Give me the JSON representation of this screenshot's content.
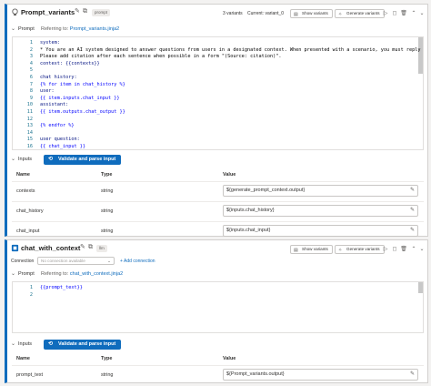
{
  "node1": {
    "title": "Prompt_variants",
    "badge": "prompt",
    "variants_count": "3 variants",
    "current_variant": "Current: variant_0",
    "show_variants": "Show variants",
    "generate_variants": "Generate variants",
    "prompt_section": "Prompt",
    "referring_to": "Referring to:",
    "file_link": "Prompt_variants.jinja2",
    "code_lines": [
      {
        "n": "1",
        "t": "system:",
        "c": "c-dark"
      },
      {
        "n": "2",
        "t": "* You are an AI system designed to answer questions from users in a designated context. When presented with a scenario, you must reply with ac",
        "c": "c-txt"
      },
      {
        "n": "3",
        "t": "Please add citation after each sentence when possible in a form \"(Source: citation)\".",
        "c": "c-txt"
      },
      {
        "n": "4",
        "t": "context: {{contexts}}",
        "c": "c-dark"
      },
      {
        "n": "5",
        "t": "",
        "c": "c-txt"
      },
      {
        "n": "6",
        "t": "chat history:",
        "c": "c-dark"
      },
      {
        "n": "7",
        "t": "{% for item in chat_history %}",
        "c": "c-blue"
      },
      {
        "n": "8",
        "t": "user:",
        "c": "c-dark"
      },
      {
        "n": "9",
        "t": "{{ item.inputs.chat_input }}",
        "c": "c-blue"
      },
      {
        "n": "10",
        "t": "assistant:",
        "c": "c-dark"
      },
      {
        "n": "11",
        "t": "{{ item.outputs.chat_output }}",
        "c": "c-blue"
      },
      {
        "n": "12",
        "t": "",
        "c": "c-txt"
      },
      {
        "n": "13",
        "t": "{% endfor %}",
        "c": "c-blue"
      },
      {
        "n": "14",
        "t": "",
        "c": "c-txt"
      },
      {
        "n": "15",
        "t": "user question:",
        "c": "c-dark"
      },
      {
        "n": "16",
        "t": "{{ chat_input }}",
        "c": "c-blue"
      }
    ],
    "inputs_label": "Inputs",
    "validate_button": "Validate and parse input",
    "columns": {
      "name": "Name",
      "type": "Type",
      "value": "Value"
    },
    "rows": [
      {
        "name": "contexts",
        "type": "string",
        "value": "${generate_prompt_context.output}"
      },
      {
        "name": "chat_history",
        "type": "string",
        "value": "${inputs.chat_history}"
      },
      {
        "name": "chat_input",
        "type": "string",
        "value": "${inputs.chat_input}"
      }
    ]
  },
  "node2": {
    "title": "chat_with_context",
    "badge": "llm",
    "show_variants": "Show variants",
    "generate_variants": "Generate variants",
    "connection_label": "Connection",
    "connection_placeholder": "No connection available",
    "add_connection": "+ Add connection",
    "prompt_section": "Prompt",
    "referring_to": "Referring to:",
    "file_link": "chat_with_context.jinja2",
    "code_lines": [
      {
        "n": "1",
        "t": "{{prompt_text}}",
        "c": "c-blue"
      },
      {
        "n": "2",
        "t": "",
        "c": "c-txt"
      }
    ],
    "inputs_label": "Inputs",
    "validate_button": "Validate and parse input",
    "columns": {
      "name": "Name",
      "type": "Type",
      "value": "Value"
    },
    "rows": [
      {
        "name": "prompt_text",
        "type": "string",
        "value": "${Prompt_variants.output}"
      }
    ]
  },
  "colors": {
    "accent": "#0f6cbd",
    "border": "#d2d0ce",
    "code_keyword": "#0000ff"
  },
  "icons": [
    "prompt-node-icon",
    "llm-node-icon",
    "edit-icon",
    "copy-icon",
    "play-icon",
    "bulb-icon",
    "delete-icon",
    "stop-icon",
    "chevron-up-icon",
    "chevron-down-icon",
    "wand-icon",
    "variants-icon"
  ]
}
